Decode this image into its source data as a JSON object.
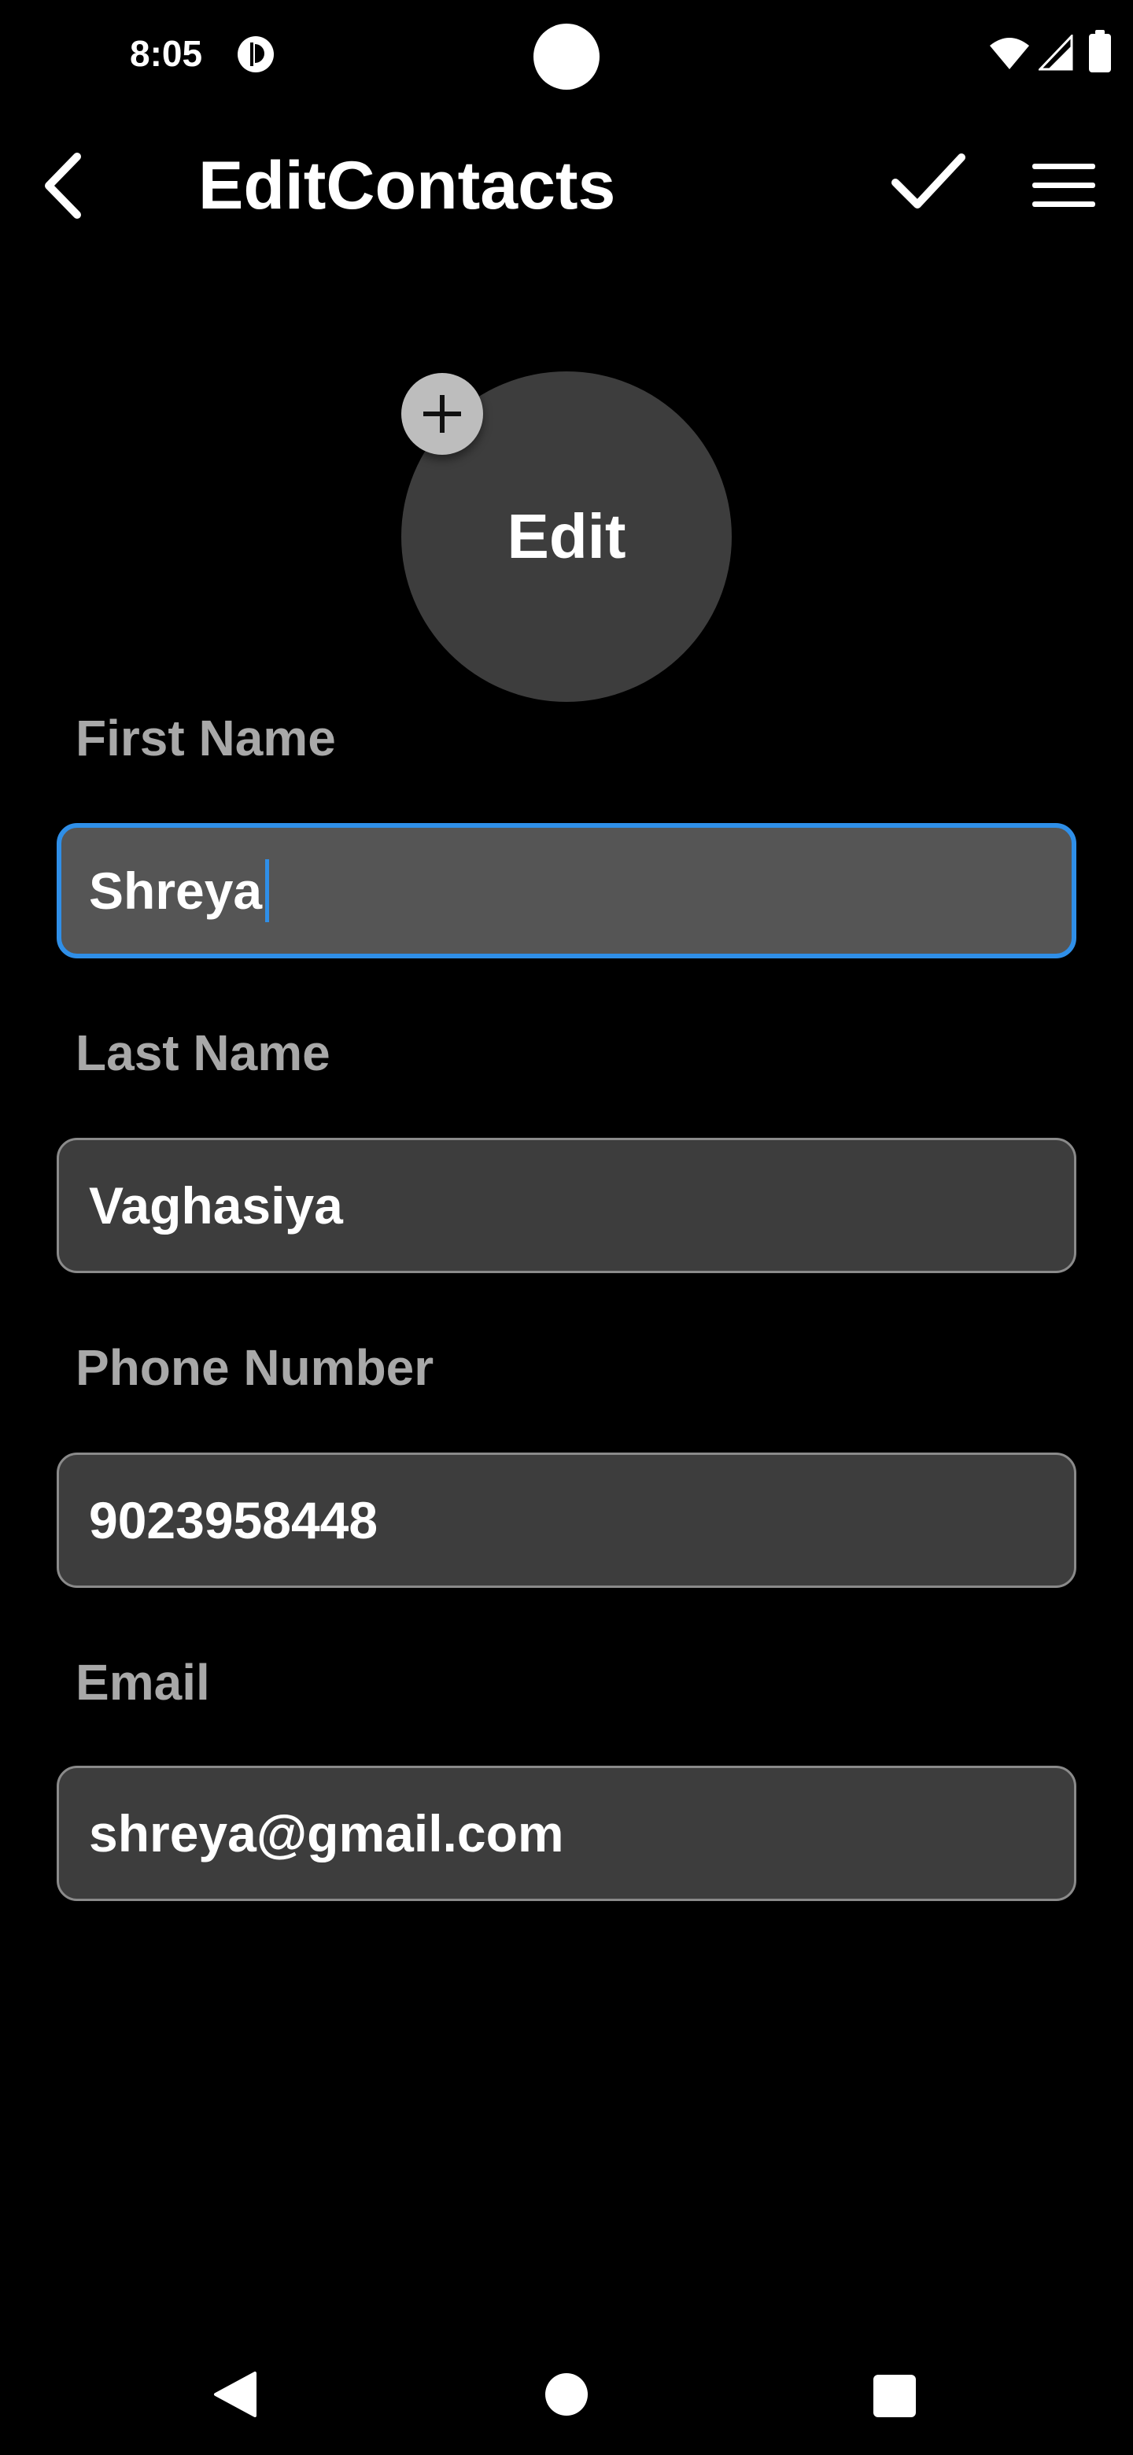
{
  "status_bar": {
    "time": "8:05",
    "icons": [
      "app-notification-icon",
      "wifi-icon",
      "signal-icon",
      "battery-icon"
    ]
  },
  "app_bar": {
    "title": "EditContacts",
    "back_icon": "back-arrow-icon",
    "save_icon": "checkmark-icon",
    "menu_icon": "hamburger-menu-icon"
  },
  "avatar": {
    "label": "Edit",
    "add_icon": "plus-icon"
  },
  "form": {
    "first_name": {
      "label": "First Name",
      "value": "Shreya",
      "focused": true
    },
    "last_name": {
      "label": "Last Name",
      "value": "Vaghasiya"
    },
    "phone": {
      "label": "Phone Number",
      "value": "9023958448"
    },
    "email": {
      "label": "Email",
      "value": "shreya@gmail.com"
    }
  },
  "nav_bar": {
    "icons": [
      "nav-back-icon",
      "nav-home-icon",
      "nav-recents-icon"
    ]
  },
  "colors": {
    "background": "#000000",
    "field_background": "#3d3d3d",
    "focused_field_background": "#555555",
    "focus_accent": "#2f8fe8",
    "label_text": "#a8a8a8"
  }
}
